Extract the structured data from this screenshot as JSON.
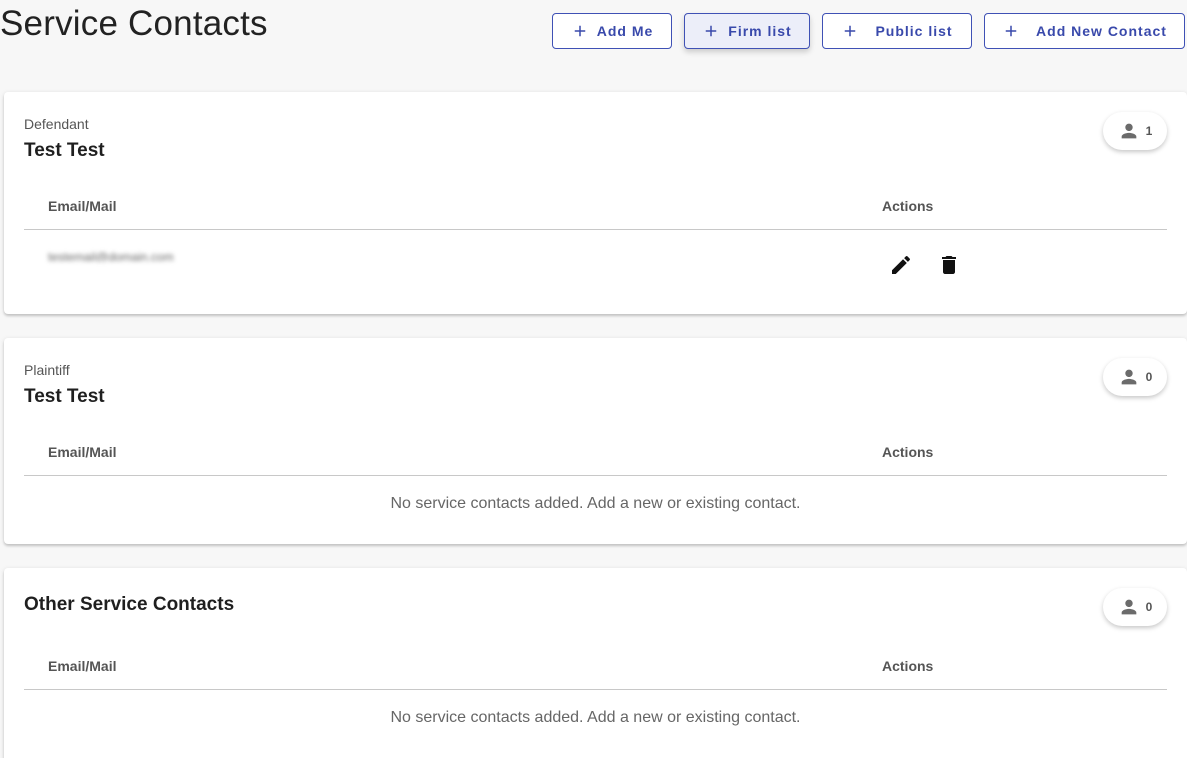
{
  "page": {
    "title": "Service Contacts"
  },
  "toolbar": {
    "add_me": "Add Me",
    "firm_list": "Firm list",
    "public_list": "Public list",
    "add_new_contact": "Add New Contact"
  },
  "table_headers": {
    "email": "Email/Mail",
    "actions": "Actions"
  },
  "empty_message": "No service contacts added. Add a new or existing contact.",
  "sections": [
    {
      "role": "Defendant",
      "name": "Test Test",
      "count": "1",
      "contacts": [
        {
          "email": "testemail@domain.com"
        }
      ]
    },
    {
      "role": "Plaintiff",
      "name": "Test Test",
      "count": "0",
      "contacts": []
    },
    {
      "role": "",
      "name": "Other Service Contacts",
      "count": "0",
      "contacts": []
    }
  ],
  "icons": {
    "add": "plus-icon",
    "person": "person-icon",
    "edit": "pencil-icon",
    "delete": "trash-icon"
  },
  "colors": {
    "accent": "#3949ab",
    "active_button_bg": "#eceef9"
  }
}
